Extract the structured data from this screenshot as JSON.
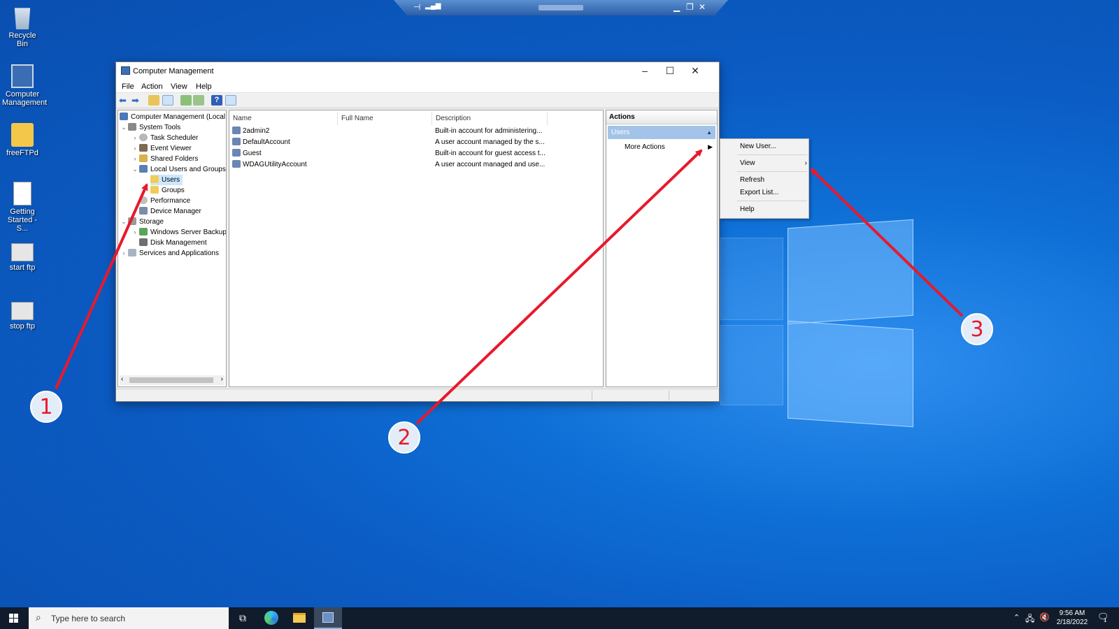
{
  "desktop": {
    "icons": [
      {
        "label": "Recycle Bin"
      },
      {
        "label": "Computer Management"
      },
      {
        "label": "freeFTPd"
      },
      {
        "label": "Getting Started - S..."
      },
      {
        "label": "start ftp"
      },
      {
        "label": "stop ftp"
      }
    ]
  },
  "window": {
    "title": "Computer Management",
    "menu": [
      "File",
      "Action",
      "View",
      "Help"
    ],
    "tree": {
      "root": "Computer Management (Local",
      "system_tools": "System Tools",
      "task_scheduler": "Task Scheduler",
      "event_viewer": "Event Viewer",
      "shared_folders": "Shared Folders",
      "local_users_groups": "Local Users and Groups",
      "users": "Users",
      "groups": "Groups",
      "performance": "Performance",
      "device_manager": "Device Manager",
      "storage": "Storage",
      "windows_server_backup": "Windows Server Backup",
      "disk_management": "Disk Management",
      "services_apps": "Services and Applications"
    },
    "list": {
      "columns": [
        "Name",
        "Full Name",
        "Description"
      ],
      "rows": [
        {
          "name": "2admin2",
          "full_name": "",
          "description": "Built-in account for administering..."
        },
        {
          "name": "DefaultAccount",
          "full_name": "",
          "description": "A user account managed by the s..."
        },
        {
          "name": "Guest",
          "full_name": "",
          "description": "Built-in account for guest access t..."
        },
        {
          "name": "WDAGUtilityAccount",
          "full_name": "",
          "description": "A user account managed and use..."
        }
      ]
    },
    "actions": {
      "header": "Actions",
      "section": "Users",
      "more_actions": "More Actions"
    }
  },
  "context_menu": {
    "new_user": "New User...",
    "view": "View",
    "refresh": "Refresh",
    "export_list": "Export List...",
    "help": "Help"
  },
  "taskbar": {
    "search_placeholder": "Type here to search",
    "time": "9:56 AM",
    "date": "2/18/2022",
    "notification_count": "1"
  },
  "callouts": [
    "1",
    "2",
    "3"
  ],
  "colors": {
    "desktop": "#0b5cc4",
    "selection": "#cce8ff",
    "actions_section": "#a4c3e8",
    "callout_arrow": "#e8192c",
    "taskbar": "#101b2b"
  }
}
